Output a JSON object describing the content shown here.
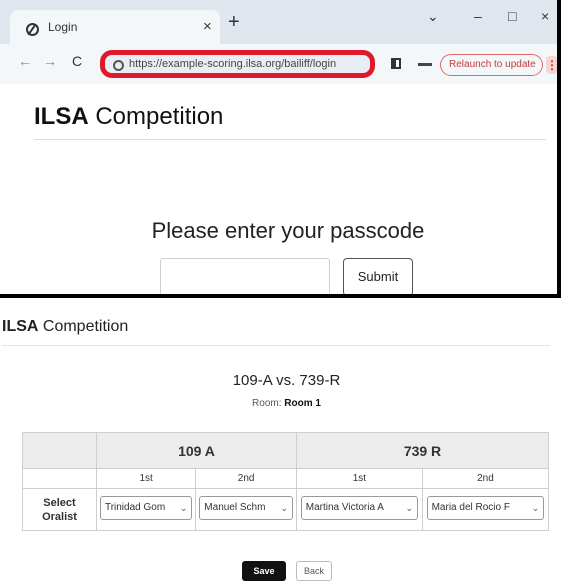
{
  "browser": {
    "tab_title": "Login",
    "tab_close": "×",
    "new_tab": "+",
    "window_controls": {
      "dropdown": "⌄",
      "minimize": "–",
      "maximize": "□",
      "close": "×"
    },
    "nav": {
      "back": "←",
      "forward": "→",
      "reload": "C"
    },
    "url": "https://example-scoring.ilsa.org/bailiff/login",
    "relaunch_label": "Relaunch to update",
    "kebab": "⋮",
    "highlight_color": "#e0182b"
  },
  "login_page": {
    "brand_bold": "ILSA",
    "brand_rest": " Competition",
    "prompt": "Please enter your passcode",
    "passcode_value": "",
    "submit_label": "Submit"
  },
  "scoring_page": {
    "brand_bold": "ILSA",
    "brand_rest": " Competition",
    "match_title": "109-A vs. 739-R",
    "room_label": "Room: ",
    "room_value": "Room 1",
    "teams": [
      {
        "name": "109 A",
        "orders": [
          "1st",
          "2nd"
        ],
        "oralists": [
          "Trinidad Gom",
          "Manuel Schm"
        ]
      },
      {
        "name": "739 R",
        "orders": [
          "1st",
          "2nd"
        ],
        "oralists": [
          "Martina Victoria A",
          "Maria del Rocio F"
        ]
      }
    ],
    "row_label_line1": "Select",
    "row_label_line2": "Oralist",
    "chevron": "⌄",
    "save_label": "Save",
    "back_label": "Back"
  }
}
